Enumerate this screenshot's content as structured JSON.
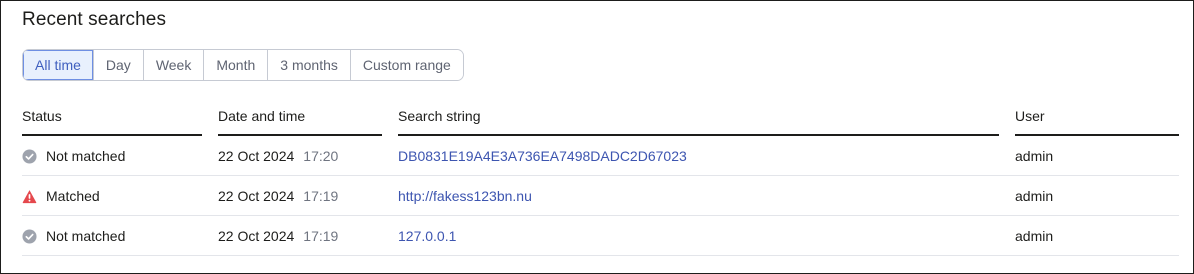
{
  "title": "Recent searches",
  "filters": [
    {
      "label": "All time",
      "active": true
    },
    {
      "label": "Day",
      "active": false
    },
    {
      "label": "Week",
      "active": false
    },
    {
      "label": "Month",
      "active": false
    },
    {
      "label": "3 months",
      "active": false
    },
    {
      "label": "Custom range",
      "active": false
    }
  ],
  "columns": {
    "status": "Status",
    "date": "Date and time",
    "search": "Search string",
    "user": "User"
  },
  "rows": [
    {
      "status": "Not matched",
      "icon": "check-circle-icon",
      "date": "22 Oct 2024",
      "time": "17:20",
      "search": "DB0831E19A4E3A736EA7498DADC2D67023",
      "user": "admin"
    },
    {
      "status": "Matched",
      "icon": "warning-triangle-icon",
      "date": "22 Oct 2024",
      "time": "17:19",
      "search": "http://fakess123bn.nu",
      "user": "admin"
    },
    {
      "status": "Not matched",
      "icon": "check-circle-icon",
      "date": "22 Oct 2024",
      "time": "17:19",
      "search": "127.0.0.1",
      "user": "admin"
    }
  ],
  "colors": {
    "accent": "#3d55b0",
    "active_filter_bg": "#e8f0fd",
    "matched_icon": "#e5484d",
    "not_matched_icon": "#9ea3ad"
  }
}
